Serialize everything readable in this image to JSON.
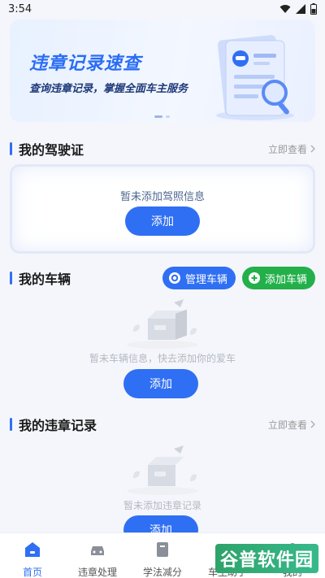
{
  "status_bar": {
    "time": "3:54"
  },
  "banner": {
    "title": "违章记录速查",
    "subtitle": "查询违章记录，掌握全面车主服务"
  },
  "license_section": {
    "title": "我的驾驶证",
    "more": "立即查看",
    "empty_text": "暂未添加驾照信息",
    "add_button": "添加"
  },
  "vehicle_section": {
    "title": "我的车辆",
    "manage_button": "管理车辆",
    "add_vehicle_button": "添加车辆",
    "empty_text": "暂未车辆信息，快去添加你的爱车",
    "add_button": "添加"
  },
  "violation_section": {
    "title": "我的违章记录",
    "more": "立即查看",
    "empty_text": "暂未添加违章记录",
    "add_button": "添加"
  },
  "tabbar": {
    "items": [
      {
        "label": "首页",
        "icon": "home-icon",
        "active": true
      },
      {
        "label": "违章处理",
        "icon": "car-icon",
        "active": false
      },
      {
        "label": "学法减分",
        "icon": "book-icon",
        "active": false
      },
      {
        "label": "车主助手",
        "icon": "assistant-icon",
        "active": false
      },
      {
        "label": "我的",
        "icon": "user-icon",
        "active": false
      }
    ]
  },
  "watermark": "谷普软件园",
  "colors": {
    "accent": "#2f6ff3",
    "green": "#23b04a",
    "background": "#f4f6fb"
  }
}
